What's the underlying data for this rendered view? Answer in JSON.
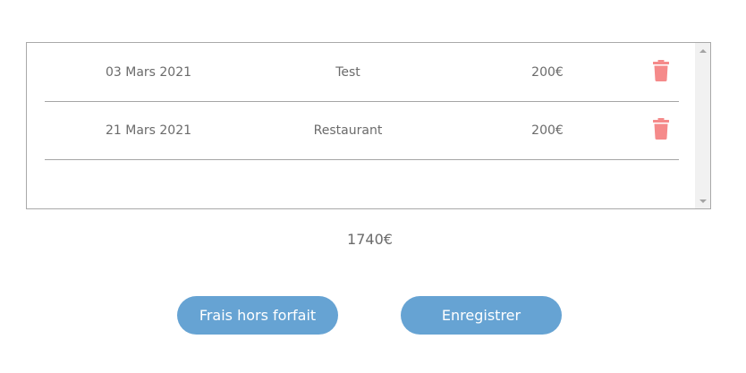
{
  "expenses": {
    "rows": [
      {
        "date": "03 Mars 2021",
        "label": "Test",
        "amount": "200€",
        "action_icon": "trash-icon"
      },
      {
        "date": "21 Mars 2021",
        "label": "Restaurant",
        "amount": "200€",
        "action_icon": "trash-icon"
      }
    ]
  },
  "total": "1740€",
  "buttons": {
    "frais_hors_forfait": "Frais hors forfait",
    "enregistrer": "Enregistrer"
  },
  "colors": {
    "accent": "#66a3d3",
    "delete_icon": "#f58a8a",
    "text": "#6b6b6b",
    "border": "#a9a9a9"
  }
}
